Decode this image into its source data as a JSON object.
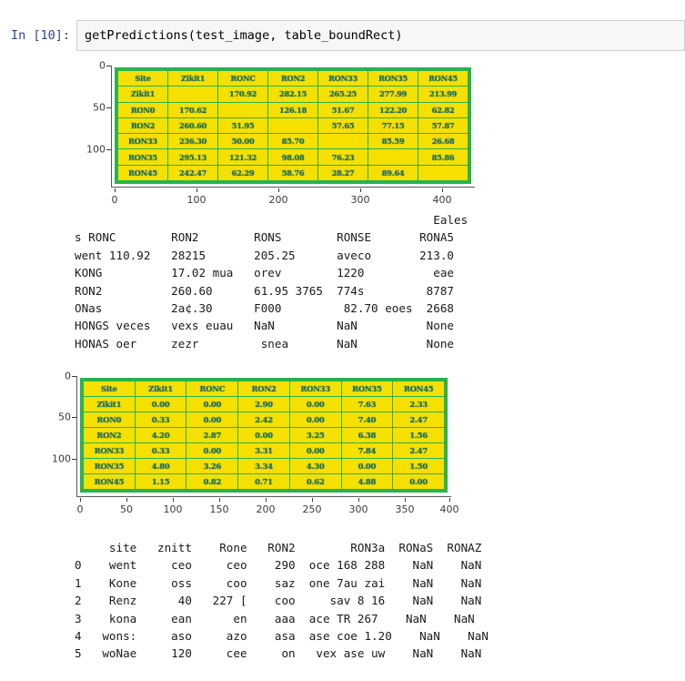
{
  "notebook": {
    "prompt": "In [10]:",
    "code": "getPredictions(test_image, table_boundRect)"
  },
  "figure1": {
    "name": "table-detection-plot-1",
    "yticks": [
      "0",
      "50",
      "100"
    ],
    "xticks": [
      "0",
      "100",
      "200",
      "300",
      "400"
    ],
    "table": {
      "header": [
        "Site",
        "Zikit1",
        "RONC",
        "RON2",
        "RON33",
        "RON35",
        "RON45"
      ],
      "rows": [
        [
          "Zikit1",
          "",
          "170.92",
          "282.15",
          "265.25",
          "277.99",
          "213.99"
        ],
        [
          "RON0",
          "170.62",
          "",
          "126.18",
          "51.67",
          "122.20",
          "62.82"
        ],
        [
          "RON2",
          "260.60",
          "51.95",
          "",
          "57.65",
          "77.15",
          "57.87"
        ],
        [
          "RON33",
          "236.30",
          "50.00",
          "85.70",
          "",
          "85.59",
          "26.68"
        ],
        [
          "RON35",
          "295.13",
          "121.32",
          "98.08",
          "76.23",
          "",
          "85.86"
        ],
        [
          "RON45",
          "242.47",
          "62.29",
          "58.76",
          "28.27",
          "89.64",
          ""
        ]
      ]
    }
  },
  "stdout1": {
    "name": "distance-matrix-text-output",
    "lines": [
      "                                                    Eales",
      "s RONC        RON2        RONS        RONSE       RONA5",
      "went 110.92   28215       205.25      aveco       213.0",
      "KONG          17.02 mua   orev        1220          eae",
      "RON2          260.60      61.95 3765  774s         8787",
      "ONas          2a¢.30      F000         82.70 eoes  2668",
      "HONGS veces   vexs euau   NaN         NaN          None",
      "HONAS oer     zezr         snea       NaN          None"
    ]
  },
  "figure2": {
    "name": "table-detection-plot-2",
    "yticks": [
      "0",
      "50",
      "100"
    ],
    "xticks": [
      "0",
      "50",
      "100",
      "150",
      "200",
      "250",
      "300",
      "350",
      "400"
    ],
    "table": {
      "header": [
        "Site",
        "Zikit1",
        "RONC",
        "RON2",
        "RON33",
        "RON35",
        "RON45"
      ],
      "rows": [
        [
          "Zikit1",
          "0.00",
          "0.00",
          "2.90",
          "0.00",
          "7.63",
          "2.33"
        ],
        [
          "RON0",
          "0.33",
          "0.00",
          "2.42",
          "0.00",
          "7.40",
          "2.47"
        ],
        [
          "RON2",
          "4.20",
          "2.87",
          "0.00",
          "3.25",
          "6.38",
          "1.56"
        ],
        [
          "RON33",
          "0.33",
          "0.00",
          "3.31",
          "0.00",
          "7.84",
          "2.47"
        ],
        [
          "RON35",
          "4.80",
          "3.26",
          "3.34",
          "4.30",
          "0.00",
          "1.50"
        ],
        [
          "RON45",
          "1.15",
          "0.82",
          "0.71",
          "0.62",
          "4.88",
          "0.00"
        ]
      ]
    }
  },
  "stdout2": {
    "name": "dataframe-text-output",
    "header": "     site   znitt    Rone   RON2        RON3a  RONaS  RONAZ",
    "lines": [
      "0    went     ceo     ceo    290  oce 168 288    NaN    NaN",
      "1    Kone     oss     coo    saz  one 7au zai    NaN    NaN",
      "2    Renz      40   227 [    coo     sav 8 16    NaN    NaN",
      "3    kona     ean      en    aaa  ace TR 267    NaN    NaN",
      "4   wons:     aso     azo    asa  ase coe 1.20    NaN    NaN",
      "5   woNae     120     cee     on   vex ase uw    NaN    NaN"
    ]
  },
  "colors": {
    "cell_fill": "#f5e000",
    "grid_line": "#2bb24c",
    "cell_text": "#1f6f63",
    "prompt_blue": "#303F9F",
    "code_bg": "#f7f7f7"
  }
}
